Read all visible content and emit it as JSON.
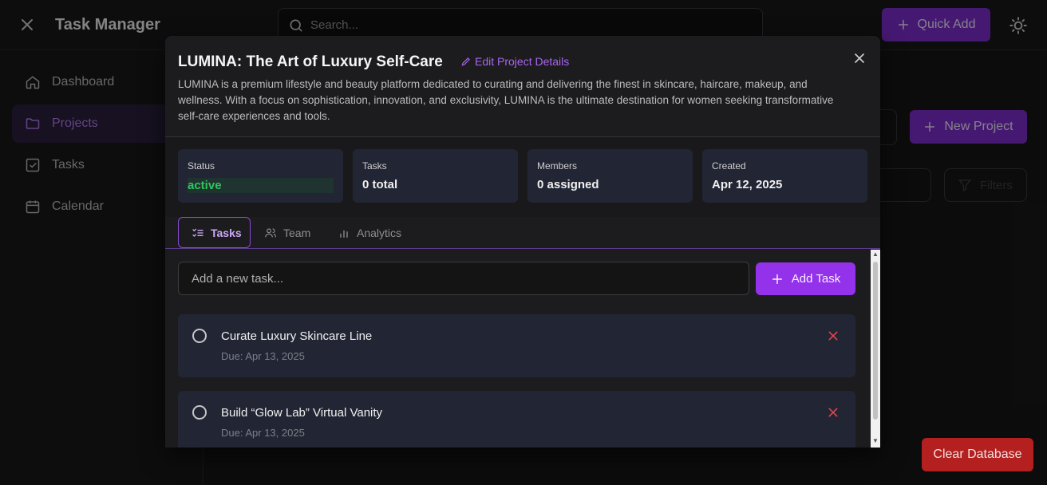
{
  "app": {
    "title": "Task Manager",
    "search_placeholder": "Search...",
    "quick_add_label": "Quick Add"
  },
  "sidebar": {
    "items": [
      {
        "label": "Dashboard",
        "icon": "home-icon",
        "active": false
      },
      {
        "label": "Projects",
        "icon": "folder-icon",
        "active": true
      },
      {
        "label": "Tasks",
        "icon": "checkbox-icon",
        "active": false
      },
      {
        "label": "Calendar",
        "icon": "calendar-icon",
        "active": false
      }
    ]
  },
  "background": {
    "new_project_label": "New Project",
    "filters_label": "Filters",
    "clear_database_label": "Clear Database"
  },
  "modal": {
    "title": "LUMINA: The Art of Luxury Self-Care",
    "edit_label": "Edit Project Details",
    "description": "LUMINA is a premium lifestyle and beauty platform dedicated to curating and delivering the finest in skincare, haircare, makeup, and wellness. With a focus on sophistication, innovation, and exclusivity, LUMINA is the ultimate destination for women seeking transformative self-care experiences and tools.",
    "stats": [
      {
        "label": "Status",
        "value": "active"
      },
      {
        "label": "Tasks",
        "value": "0 total"
      },
      {
        "label": "Members",
        "value": "0 assigned"
      },
      {
        "label": "Created",
        "value": "Apr 12, 2025"
      }
    ],
    "tabs": [
      {
        "label": "Tasks",
        "icon": "list-check-icon",
        "active": true
      },
      {
        "label": "Team",
        "icon": "users-icon",
        "active": false
      },
      {
        "label": "Analytics",
        "icon": "bar-chart-icon",
        "active": false
      }
    ],
    "new_task_placeholder": "Add a new task...",
    "add_task_label": "Add Task",
    "tasks": [
      {
        "title": "Curate Luxury Skincare Line",
        "due": "Due: Apr 13, 2025"
      },
      {
        "title": "Build “Glow Lab” Virtual Vanity",
        "due": "Due: Apr 13, 2025"
      }
    ]
  },
  "colors": {
    "accent": "#7e2fd0",
    "accent_light": "#a865ef",
    "status_active": "#30c65b",
    "danger": "#b3201f"
  }
}
